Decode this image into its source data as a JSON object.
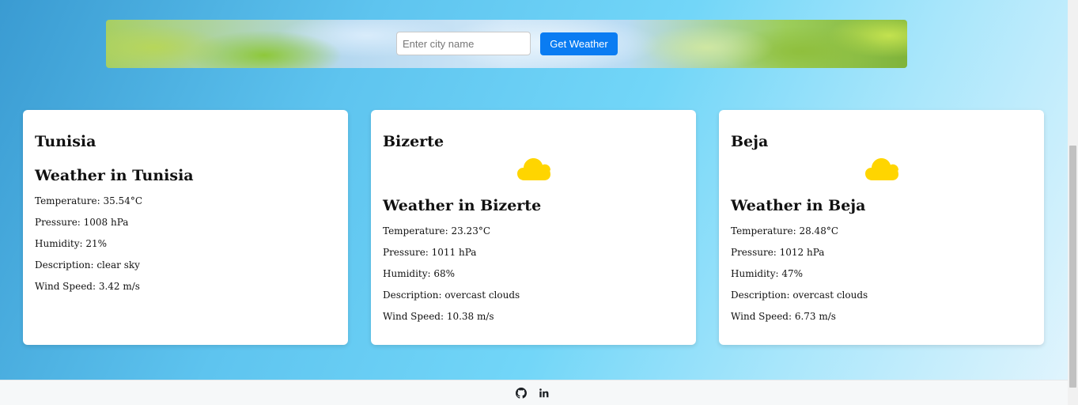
{
  "search": {
    "placeholder": "Enter city name",
    "value": "",
    "button_label": "Get Weather"
  },
  "cards": [
    {
      "city": "Tunisia",
      "heading": "Weather in Tunisia",
      "icon": "none",
      "temperature": "Temperature: 35.54°C",
      "pressure": "Pressure: 1008 hPa",
      "humidity": "Humidity: 21%",
      "description": "Description: clear sky",
      "wind": "Wind Speed: 3.42 m/s"
    },
    {
      "city": "Bizerte",
      "heading": "Weather in Bizerte",
      "icon": "cloud-icon",
      "temperature": "Temperature: 23.23°C",
      "pressure": "Pressure: 1011 hPa",
      "humidity": "Humidity: 68%",
      "description": "Description: overcast clouds",
      "wind": "Wind Speed: 10.38 m/s"
    },
    {
      "city": "Beja",
      "heading": "Weather in Beja",
      "icon": "cloud-icon",
      "temperature": "Temperature: 28.48°C",
      "pressure": "Pressure: 1012 hPa",
      "humidity": "Humidity: 47%",
      "description": "Description: overcast clouds",
      "wind": "Wind Speed: 6.73 m/s"
    }
  ],
  "footer": {
    "links": [
      "github-icon",
      "linkedin-icon"
    ]
  },
  "colors": {
    "button": "#0a7cf2",
    "cloud": "#ffd500",
    "footer_bg": "#f6f8f9"
  }
}
